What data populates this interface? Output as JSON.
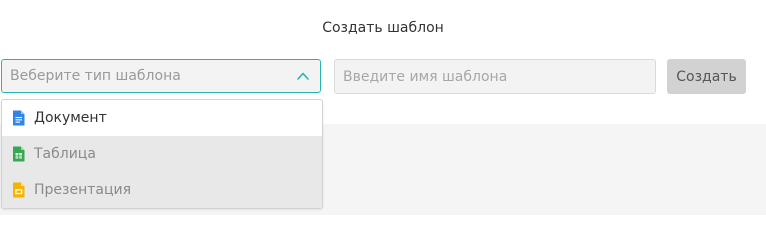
{
  "page": {
    "title": "Создать шаблон"
  },
  "template_type_select": {
    "placeholder": "Веберите тип шаблона",
    "open": true,
    "chevron_icon": "chevron-up-icon",
    "accent_color": "#26b5b5"
  },
  "template_name_input": {
    "value": "",
    "placeholder": "Введите имя шаблона"
  },
  "create_button": {
    "label": "Создать"
  },
  "dropdown": {
    "options": [
      {
        "label": "Документ",
        "icon": "document-icon",
        "color": "#2f86e6",
        "highlighted": true
      },
      {
        "label": "Таблица",
        "icon": "spreadsheet-icon",
        "color": "#35a852",
        "highlighted": false
      },
      {
        "label": "Презентация",
        "icon": "presentation-icon",
        "color": "#f5b400",
        "highlighted": false
      }
    ]
  }
}
